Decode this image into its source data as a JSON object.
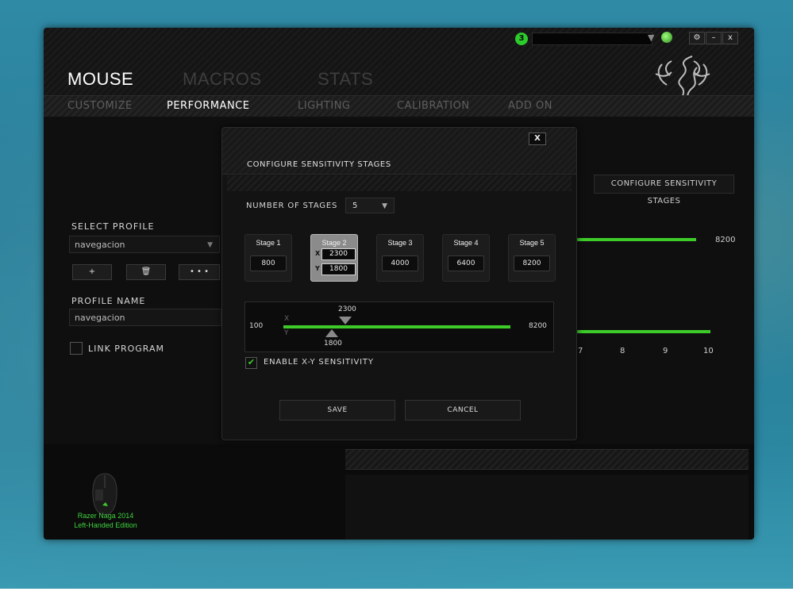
{
  "topbar": {
    "notification_count": "3",
    "settings_icon": "gear-icon",
    "minimize_label": "–",
    "close_label": "x"
  },
  "main_tabs": [
    {
      "label": "MOUSE",
      "active": true
    },
    {
      "label": "MACROS",
      "active": false
    },
    {
      "label": "STATS",
      "active": false
    }
  ],
  "sub_tabs": [
    {
      "label": "CUSTOMIZE",
      "active": false
    },
    {
      "label": "PERFORMANCE",
      "active": true
    },
    {
      "label": "LIGHTING",
      "active": false
    },
    {
      "label": "CALIBRATION",
      "active": false
    },
    {
      "label": "ADD ON",
      "active": false
    }
  ],
  "profile": {
    "select_label": "SELECT PROFILE",
    "selected": "navegacion",
    "add_label": "+",
    "more_label": "• • •",
    "name_label": "PROFILE NAME",
    "name_value": "navegacion",
    "link_label": "LINK PROGRAM"
  },
  "background_panel": {
    "configure_button": "CONFIGURE SENSITIVITY STAGES",
    "max_value": "8200",
    "axis_numbers": [
      "7",
      "8",
      "9",
      "10"
    ]
  },
  "device": {
    "name_line1": "Razer Naga 2014",
    "name_line2": "Left-Handed Edition"
  },
  "modal": {
    "title": "CONFIGURE SENSITIVITY STAGES",
    "close_label": "X",
    "num_stages_label": "NUMBER OF STAGES",
    "num_stages_value": "5",
    "stages": [
      {
        "name": "Stage 1",
        "value": "800"
      },
      {
        "name": "Stage 2",
        "x": "2300",
        "y": "1800",
        "active": true
      },
      {
        "name": "Stage 3",
        "value": "4000"
      },
      {
        "name": "Stage 4",
        "value": "6400"
      },
      {
        "name": "Stage 5",
        "value": "8200"
      }
    ],
    "slider": {
      "min": "100",
      "max": "8200",
      "x_label": "X",
      "y_label": "Y",
      "x_value": "2300",
      "y_value": "1800"
    },
    "xy_checkbox_label": "ENABLE X-Y SENSITIVITY",
    "xy_enabled": true,
    "save_label": "SAVE",
    "cancel_label": "CANCEL"
  },
  "colors": {
    "accent_green": "#3ecb2a",
    "active_tab": "#ffffff",
    "inactive_tab": "#4a4a4a"
  }
}
